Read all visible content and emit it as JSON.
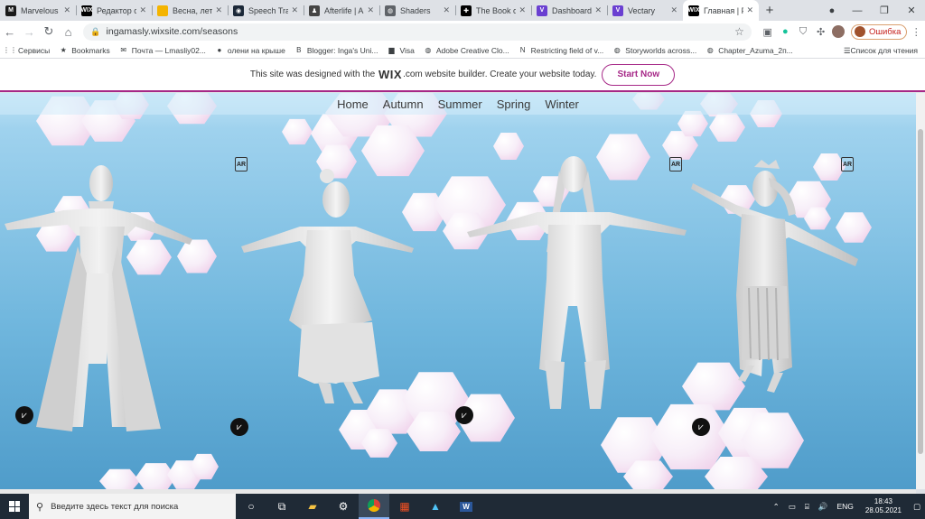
{
  "browser": {
    "tabs": [
      {
        "label": "Marvelous D",
        "icon": "marvelous-icon",
        "color": "#1a1a1a",
        "glyph": "M"
      },
      {
        "label": "Редактор са",
        "icon": "wix-icon",
        "color": "#000000",
        "glyph": "WIX"
      },
      {
        "label": "Весна, лето",
        "icon": "slides-icon",
        "color": "#f4b400",
        "glyph": ""
      },
      {
        "label": "Speech Trans",
        "icon": "steam-icon",
        "color": "#1b2838",
        "glyph": "◉"
      },
      {
        "label": "Afterlife | A",
        "icon": "figure-icon",
        "color": "#444444",
        "glyph": "♟"
      },
      {
        "label": "Shaders",
        "icon": "globe-icon",
        "color": "#5f6368",
        "glyph": "◍"
      },
      {
        "label": "The Book of",
        "icon": "cross-icon",
        "color": "#000000",
        "glyph": "✚"
      },
      {
        "label": "Dashboard",
        "icon": "vectary-icon",
        "color": "#6a3fd1",
        "glyph": "V"
      },
      {
        "label": "Vectary",
        "icon": "vectary-icon",
        "color": "#6a3fd1",
        "glyph": "V"
      },
      {
        "label": "Главная | Р",
        "icon": "wix-icon",
        "color": "#000000",
        "glyph": "WIX",
        "active": true
      }
    ],
    "url": "ingamasly.wixsite.com/seasons",
    "error_label": "Ошибка",
    "bookmarks": [
      {
        "label": "Сервисы",
        "icon": "apps-grid-icon",
        "glyph": "⋮⋮"
      },
      {
        "label": "Bookmarks",
        "icon": "star-icon",
        "glyph": "★"
      },
      {
        "label": "Почта — Lmasliy02...",
        "icon": "mail-icon",
        "glyph": "✉"
      },
      {
        "label": "олени на крыше",
        "icon": "red-circle-icon",
        "glyph": "●"
      },
      {
        "label": "Blogger: Inga's Uni...",
        "icon": "blogger-icon",
        "glyph": "B"
      },
      {
        "label": "Visa",
        "icon": "folder-icon",
        "glyph": "▆"
      },
      {
        "label": "Adobe Creative Clo...",
        "icon": "globe-icon",
        "glyph": "◍"
      },
      {
        "label": "Restricting field of v...",
        "icon": "n-icon",
        "glyph": "N"
      },
      {
        "label": "Storyworlds across...",
        "icon": "globe-icon",
        "glyph": "◍"
      },
      {
        "label": "Chapter_Azuma_2п...",
        "icon": "globe-icon",
        "glyph": "◍"
      }
    ],
    "reading_list": "Список для чтения"
  },
  "banner": {
    "text_before": "This site was designed with the",
    "brand": "WIX",
    "brand_suffix": ".com",
    "text_after": "website builder. Create your website today.",
    "cta": "Start Now"
  },
  "site": {
    "menu": [
      "Home",
      "Autumn",
      "Summer",
      "Spring",
      "Winter"
    ],
    "ar_label": "AR"
  },
  "taskbar": {
    "search_placeholder": "Введите здесь текст для поиска",
    "lang": "ENG",
    "time": "18:43",
    "date": "28.05.2021"
  }
}
